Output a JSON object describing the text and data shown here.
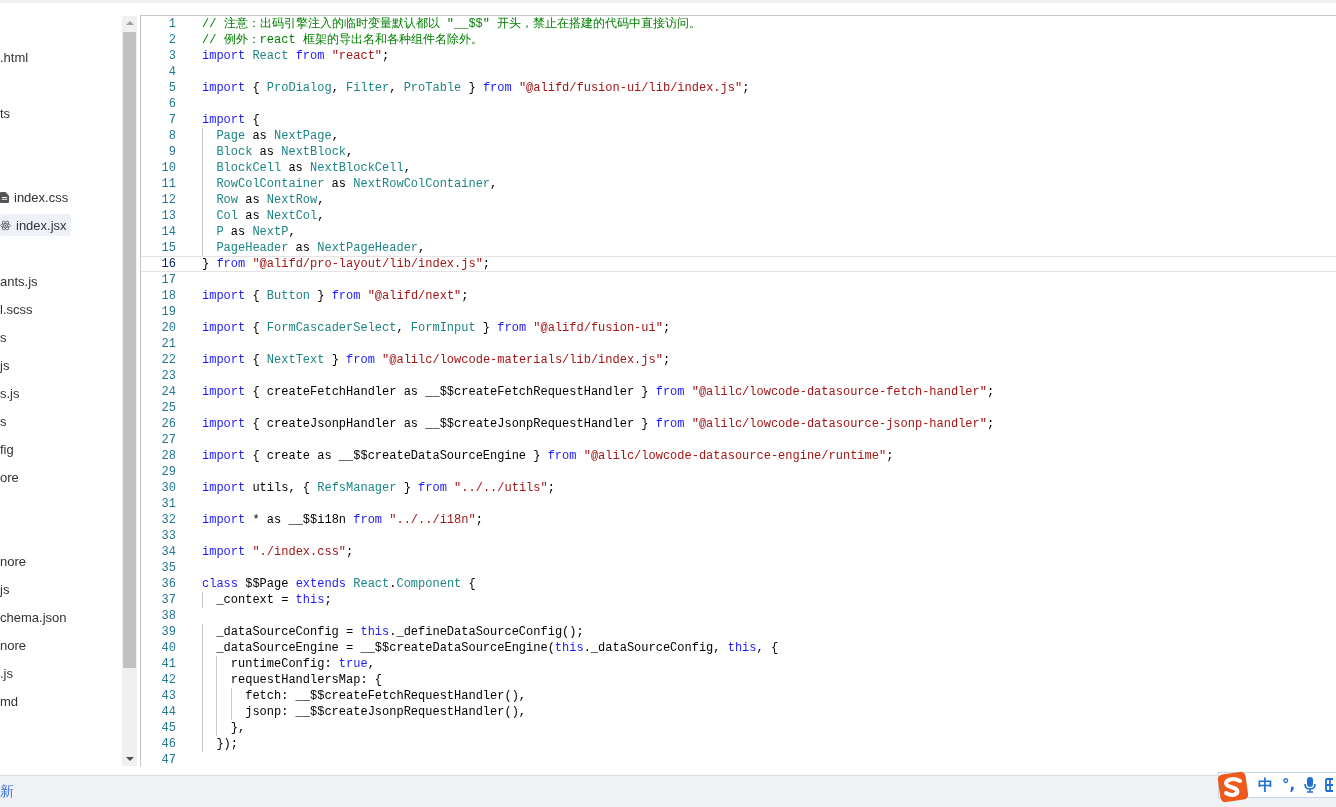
{
  "file_tree": [
    {
      "kind": "file",
      "label": ".html",
      "selected": false
    },
    {
      "kind": "hidden"
    },
    {
      "kind": "file",
      "label": "ts",
      "selected": false
    },
    {
      "kind": "hidden"
    },
    {
      "kind": "hidden"
    },
    {
      "kind": "document_file",
      "label": "index.css",
      "selected": false
    },
    {
      "kind": "react_file",
      "label": "index.jsx",
      "selected": true
    },
    {
      "kind": "hidden"
    },
    {
      "kind": "file",
      "label": "ants.js",
      "selected": false
    },
    {
      "kind": "file",
      "label": "l.scss",
      "selected": false
    },
    {
      "kind": "file",
      "label": "s",
      "selected": false
    },
    {
      "kind": "file",
      "label": "js",
      "selected": false
    },
    {
      "kind": "file",
      "label": "s.js",
      "selected": false
    },
    {
      "kind": "file",
      "label": "s",
      "selected": false
    },
    {
      "kind": "file",
      "label": "fig",
      "selected": false
    },
    {
      "kind": "file",
      "label": "ore",
      "selected": false
    },
    {
      "kind": "hidden"
    },
    {
      "kind": "hidden"
    },
    {
      "kind": "file",
      "label": "nore",
      "selected": false
    },
    {
      "kind": "file",
      "label": "js",
      "selected": false
    },
    {
      "kind": "file",
      "label": "chema.json",
      "selected": false
    },
    {
      "kind": "file",
      "label": "nore",
      "selected": false
    },
    {
      "kind": "file",
      "label": ".js",
      "selected": false
    },
    {
      "kind": "file",
      "label": "md",
      "selected": false
    }
  ],
  "editor": {
    "lines": [
      {
        "number": "1",
        "current": false,
        "tokens": [
          {
            "text": "// 注意：出码引擎注入的临时变量默认都以 \"__$$\" 开头，禁止在搭建的代码中直接访问。",
            "kind": "comment"
          }
        ]
      },
      {
        "number": "2",
        "current": false,
        "tokens": [
          {
            "text": "// 例外：react 框架的导出名和各种组件名除外。",
            "kind": "comment"
          }
        ]
      },
      {
        "number": "3",
        "current": false,
        "tokens": [
          {
            "text": "import",
            "kind": "keyword"
          },
          {
            "text": " React",
            "kind": "name"
          },
          {
            "text": " from",
            "kind": "keyword"
          },
          {
            "text": " \"react\"",
            "kind": "string"
          },
          {
            "text": ";",
            "kind": "plain"
          }
        ]
      },
      {
        "number": "4",
        "current": false
      },
      {
        "number": "5",
        "current": false,
        "tokens": [
          {
            "text": "import",
            "kind": "keyword"
          },
          {
            "text": " {",
            "kind": "plain"
          },
          {
            "text": " ProDialog",
            "kind": "name"
          },
          {
            "text": ",",
            "kind": "plain"
          },
          {
            "text": " Filter",
            "kind": "name"
          },
          {
            "text": ",",
            "kind": "plain"
          },
          {
            "text": " ProTable",
            "kind": "name"
          },
          {
            "text": " }",
            "kind": "plain"
          },
          {
            "text": " from",
            "kind": "keyword"
          },
          {
            "text": " \"@alifd/fusion-ui/lib/index.js\"",
            "kind": "string"
          },
          {
            "text": ";",
            "kind": "plain"
          }
        ]
      },
      {
        "number": "6",
        "current": false
      },
      {
        "number": "7",
        "current": false,
        "tokens": [
          {
            "text": "import",
            "kind": "keyword"
          },
          {
            "text": " {",
            "kind": "plain"
          }
        ]
      },
      {
        "number": "8",
        "current": false,
        "tokens": [
          {
            "text": "  Page",
            "kind": "name"
          },
          {
            "text": " as",
            "kind": "plain"
          },
          {
            "text": " NextPage",
            "kind": "name"
          },
          {
            "text": ",",
            "kind": "plain"
          }
        ]
      },
      {
        "number": "9",
        "current": false,
        "tokens": [
          {
            "text": "  Block",
            "kind": "name"
          },
          {
            "text": " as",
            "kind": "plain"
          },
          {
            "text": " NextBlock",
            "kind": "name"
          },
          {
            "text": ",",
            "kind": "plain"
          }
        ]
      },
      {
        "number": "10",
        "current": false,
        "tokens": [
          {
            "text": "  BlockCell",
            "kind": "name"
          },
          {
            "text": " as",
            "kind": "plain"
          },
          {
            "text": " NextBlockCell",
            "kind": "name"
          },
          {
            "text": ",",
            "kind": "plain"
          }
        ]
      },
      {
        "number": "11",
        "current": false,
        "tokens": [
          {
            "text": "  RowColContainer",
            "kind": "name"
          },
          {
            "text": " as",
            "kind": "plain"
          },
          {
            "text": " NextRowColContainer",
            "kind": "name"
          },
          {
            "text": ",",
            "kind": "plain"
          }
        ]
      },
      {
        "number": "12",
        "current": false,
        "tokens": [
          {
            "text": "  Row",
            "kind": "name"
          },
          {
            "text": " as",
            "kind": "plain"
          },
          {
            "text": " NextRow",
            "kind": "name"
          },
          {
            "text": ",",
            "kind": "plain"
          }
        ]
      },
      {
        "number": "13",
        "current": false,
        "tokens": [
          {
            "text": "  Col",
            "kind": "name"
          },
          {
            "text": " as",
            "kind": "plain"
          },
          {
            "text": " NextCol",
            "kind": "name"
          },
          {
            "text": ",",
            "kind": "plain"
          }
        ]
      },
      {
        "number": "14",
        "current": false,
        "tokens": [
          {
            "text": "  P",
            "kind": "name"
          },
          {
            "text": " as",
            "kind": "plain"
          },
          {
            "text": " NextP",
            "kind": "name"
          },
          {
            "text": ",",
            "kind": "plain"
          }
        ]
      },
      {
        "number": "15",
        "current": false,
        "tokens": [
          {
            "text": "  PageHeader",
            "kind": "name"
          },
          {
            "text": " as",
            "kind": "plain"
          },
          {
            "text": " NextPageHeader",
            "kind": "name"
          },
          {
            "text": ",",
            "kind": "plain"
          }
        ]
      },
      {
        "number": "16",
        "current": true,
        "tokens": [
          {
            "text": "}",
            "kind": "plain"
          },
          {
            "text": " from",
            "kind": "keyword"
          },
          {
            "text": " \"@alifd/pro-layout/lib/index.js\"",
            "kind": "string"
          },
          {
            "text": ";",
            "kind": "plain"
          }
        ]
      },
      {
        "number": "17",
        "current": false
      },
      {
        "number": "18",
        "current": false,
        "tokens": [
          {
            "text": "import",
            "kind": "keyword"
          },
          {
            "text": " {",
            "kind": "plain"
          },
          {
            "text": " Button",
            "kind": "name"
          },
          {
            "text": " }",
            "kind": "plain"
          },
          {
            "text": " from",
            "kind": "keyword"
          },
          {
            "text": " \"@alifd/next\"",
            "kind": "string"
          },
          {
            "text": ";",
            "kind": "plain"
          }
        ]
      },
      {
        "number": "19",
        "current": false
      },
      {
        "number": "20",
        "current": false,
        "tokens": [
          {
            "text": "import",
            "kind": "keyword"
          },
          {
            "text": " {",
            "kind": "plain"
          },
          {
            "text": " FormCascaderSelect",
            "kind": "name"
          },
          {
            "text": ",",
            "kind": "plain"
          },
          {
            "text": " FormInput",
            "kind": "name"
          },
          {
            "text": " }",
            "kind": "plain"
          },
          {
            "text": " from",
            "kind": "keyword"
          },
          {
            "text": " \"@alifd/fusion-ui\"",
            "kind": "string"
          },
          {
            "text": ";",
            "kind": "plain"
          }
        ]
      },
      {
        "number": "21",
        "current": false
      },
      {
        "number": "22",
        "current": false,
        "tokens": [
          {
            "text": "import",
            "kind": "keyword"
          },
          {
            "text": " {",
            "kind": "plain"
          },
          {
            "text": " NextText",
            "kind": "name"
          },
          {
            "text": " }",
            "kind": "plain"
          },
          {
            "text": " from",
            "kind": "keyword"
          },
          {
            "text": " \"@alilc/lowcode-materials/lib/index.js\"",
            "kind": "string"
          },
          {
            "text": ";",
            "kind": "plain"
          }
        ]
      },
      {
        "number": "23",
        "current": false
      },
      {
        "number": "24",
        "current": false,
        "tokens": [
          {
            "text": "import",
            "kind": "keyword"
          },
          {
            "text": " { createFetchHandler as __$$createFetchRequestHandler }",
            "kind": "plain"
          },
          {
            "text": " from",
            "kind": "keyword"
          },
          {
            "text": " \"@alilc/lowcode-datasource-fetch-handler\"",
            "kind": "string"
          },
          {
            "text": ";",
            "kind": "plain"
          }
        ]
      },
      {
        "number": "25",
        "current": false
      },
      {
        "number": "26",
        "current": false,
        "tokens": [
          {
            "text": "import",
            "kind": "keyword"
          },
          {
            "text": " { createJsonpHandler as __$$createJsonpRequestHandler }",
            "kind": "plain"
          },
          {
            "text": " from",
            "kind": "keyword"
          },
          {
            "text": " \"@alilc/lowcode-datasource-jsonp-handler\"",
            "kind": "string"
          },
          {
            "text": ";",
            "kind": "plain"
          }
        ]
      },
      {
        "number": "27",
        "current": false
      },
      {
        "number": "28",
        "current": false,
        "tokens": [
          {
            "text": "import",
            "kind": "keyword"
          },
          {
            "text": " { create as __$$createDataSourceEngine }",
            "kind": "plain"
          },
          {
            "text": " from",
            "kind": "keyword"
          },
          {
            "text": " \"@alilc/lowcode-datasource-engine/runtime\"",
            "kind": "string"
          },
          {
            "text": ";",
            "kind": "plain"
          }
        ]
      },
      {
        "number": "29",
        "current": false
      },
      {
        "number": "30",
        "current": false,
        "tokens": [
          {
            "text": "import",
            "kind": "keyword"
          },
          {
            "text": " utils, {",
            "kind": "plain"
          },
          {
            "text": " RefsManager",
            "kind": "name"
          },
          {
            "text": " }",
            "kind": "plain"
          },
          {
            "text": " from",
            "kind": "keyword"
          },
          {
            "text": " \"../../utils\"",
            "kind": "string"
          },
          {
            "text": ";",
            "kind": "plain"
          }
        ]
      },
      {
        "number": "31",
        "current": false
      },
      {
        "number": "32",
        "current": false,
        "tokens": [
          {
            "text": "import",
            "kind": "keyword"
          },
          {
            "text": " * as __$$i18n",
            "kind": "plain"
          },
          {
            "text": " from",
            "kind": "keyword"
          },
          {
            "text": " \"../../i18n\"",
            "kind": "string"
          },
          {
            "text": ";",
            "kind": "plain"
          }
        ]
      },
      {
        "number": "33",
        "current": false
      },
      {
        "number": "34",
        "current": false,
        "tokens": [
          {
            "text": "import",
            "kind": "keyword"
          },
          {
            "text": " \"./index.css\"",
            "kind": "string"
          },
          {
            "text": ";",
            "kind": "plain"
          }
        ]
      },
      {
        "number": "35",
        "current": false
      },
      {
        "number": "36",
        "current": false,
        "tokens": [
          {
            "text": "class",
            "kind": "keyword"
          },
          {
            "text": " $$Page",
            "kind": "plain"
          },
          {
            "text": " extends",
            "kind": "keyword"
          },
          {
            "text": " React",
            "kind": "name"
          },
          {
            "text": ".",
            "kind": "plain"
          },
          {
            "text": "Component",
            "kind": "name"
          },
          {
            "text": " {",
            "kind": "plain"
          }
        ]
      },
      {
        "number": "37",
        "current": false,
        "tokens": [
          {
            "text": "  _context =",
            "kind": "plain"
          },
          {
            "text": " this",
            "kind": "keyword"
          },
          {
            "text": ";",
            "kind": "plain"
          }
        ]
      },
      {
        "number": "38",
        "current": false
      },
      {
        "number": "39",
        "current": false,
        "tokens": [
          {
            "text": "  _dataSourceConfig =",
            "kind": "plain"
          },
          {
            "text": " this",
            "kind": "keyword"
          },
          {
            "text": "._defineDataSourceConfig();",
            "kind": "plain"
          }
        ]
      },
      {
        "number": "40",
        "current": false,
        "tokens": [
          {
            "text": "  _dataSourceEngine = __$$createDataSourceEngine(",
            "kind": "plain"
          },
          {
            "text": "this",
            "kind": "keyword"
          },
          {
            "text": "._dataSourceConfig,",
            "kind": "plain"
          },
          {
            "text": " this",
            "kind": "keyword"
          },
          {
            "text": ", {",
            "kind": "plain"
          }
        ]
      },
      {
        "number": "41",
        "current": false,
        "tokens": [
          {
            "text": "    runtimeConfig:",
            "kind": "plain"
          },
          {
            "text": " true",
            "kind": "keyword"
          },
          {
            "text": ",",
            "kind": "plain"
          }
        ]
      },
      {
        "number": "42",
        "current": false,
        "tokens": [
          {
            "text": "    requestHandlersMap: {",
            "kind": "plain"
          }
        ]
      },
      {
        "number": "43",
        "current": false,
        "tokens": [
          {
            "text": "      fetch: __$$createFetchRequestHandler(),",
            "kind": "plain"
          }
        ]
      },
      {
        "number": "44",
        "current": false,
        "tokens": [
          {
            "text": "      jsonp: __$$createJsonpRequestHandler(),",
            "kind": "plain"
          }
        ]
      },
      {
        "number": "45",
        "current": false,
        "tokens": [
          {
            "text": "    },",
            "kind": "plain"
          }
        ]
      },
      {
        "number": "46",
        "current": false,
        "tokens": [
          {
            "text": "  });",
            "kind": "plain"
          }
        ]
      },
      {
        "number": "47",
        "current": false
      }
    ]
  },
  "status_bar": {
    "text": "新"
  },
  "ime_toolbar": {
    "items": [
      {
        "kind": "text",
        "label": "中"
      },
      {
        "kind": "text",
        "label": "°,"
      },
      {
        "kind": "mic"
      },
      {
        "kind": "grid"
      }
    ]
  }
}
